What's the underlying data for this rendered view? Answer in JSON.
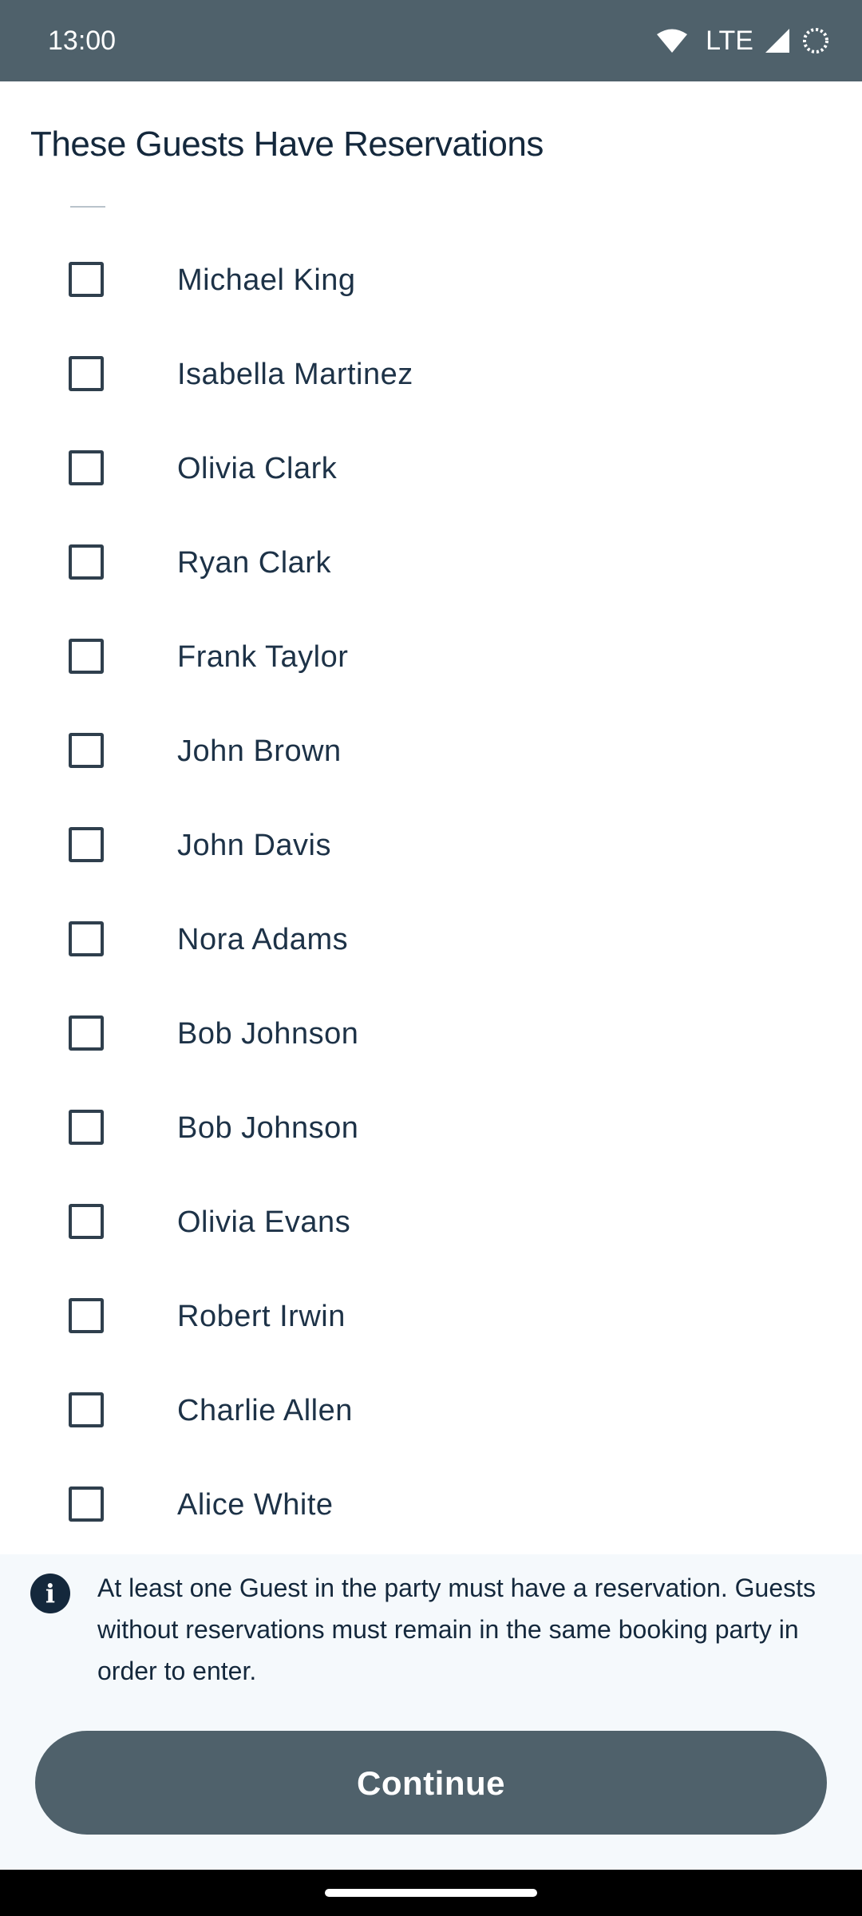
{
  "status_bar": {
    "time": "13:00",
    "network": "LTE",
    "icons": [
      "wifi-icon",
      "cellular-signal-icon",
      "loading-circle-icon"
    ]
  },
  "header": {
    "title": "These Guests Have Reservations"
  },
  "guests": [
    {
      "name": "Michael King",
      "checked": false
    },
    {
      "name": "Isabella Martinez",
      "checked": false
    },
    {
      "name": "Olivia Clark",
      "checked": false
    },
    {
      "name": "Ryan Clark",
      "checked": false
    },
    {
      "name": "Frank Taylor",
      "checked": false
    },
    {
      "name": "John Brown",
      "checked": false
    },
    {
      "name": "John Davis",
      "checked": false
    },
    {
      "name": "Nora Adams",
      "checked": false
    },
    {
      "name": "Bob Johnson",
      "checked": false
    },
    {
      "name": "Bob Johnson",
      "checked": false
    },
    {
      "name": "Olivia Evans",
      "checked": false
    },
    {
      "name": "Robert Irwin",
      "checked": false
    },
    {
      "name": "Charlie Allen",
      "checked": false
    },
    {
      "name": "Alice White",
      "checked": false
    }
  ],
  "info": {
    "icon": "info-icon",
    "text": "At least one Guest in the party must have a reservation. Guests without reservations must remain in the same booking party in order to enter."
  },
  "continue_button": {
    "label": "Continue"
  },
  "colors": {
    "status_bar": "#4f616b",
    "button": "#4f616b",
    "text": "#1d3247",
    "info_panel": "#f5f9fc"
  }
}
